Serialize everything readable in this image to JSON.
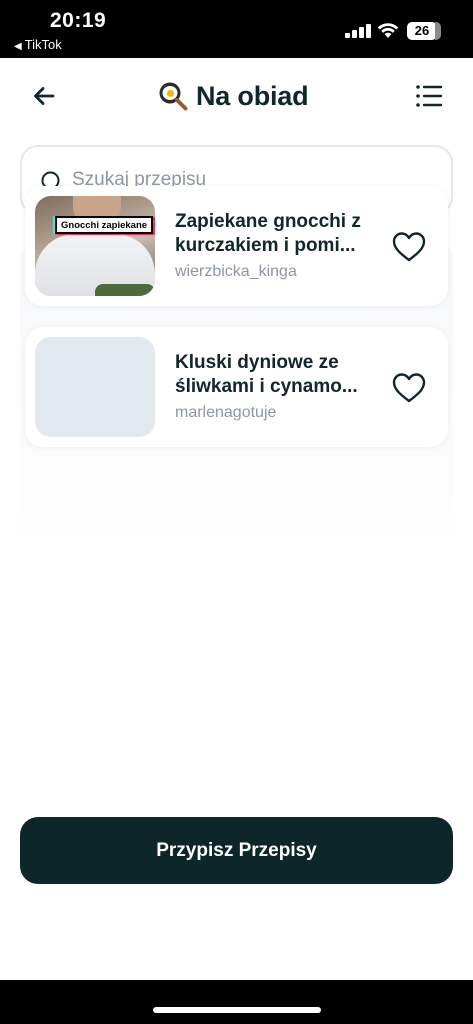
{
  "status_bar": {
    "time": "20:19",
    "back_app": "TikTok",
    "battery": "26"
  },
  "header": {
    "title": "Na obiad",
    "title_icon": "frying-pan-icon"
  },
  "search": {
    "placeholder": "Szukaj przepisu",
    "value": ""
  },
  "recipes": [
    {
      "title": "Zapiekane gnocchi z kurczakiem i pomi...",
      "author": "wierzbicka_kinga",
      "thumbnail_caption": "Gnocchi zapiekane",
      "favorited": false
    },
    {
      "title": "Kluski dyniowe ze śliwkami i cynamo...",
      "author": "marlenagotuje",
      "thumbnail_caption": "",
      "favorited": false
    }
  ],
  "actions": {
    "assign_label": "Przypisz Przepisy"
  },
  "colors": {
    "primary_dark": "#0c2629",
    "text_primary": "#12262b",
    "text_secondary": "#8e96a3",
    "border": "#e4e7ef"
  }
}
